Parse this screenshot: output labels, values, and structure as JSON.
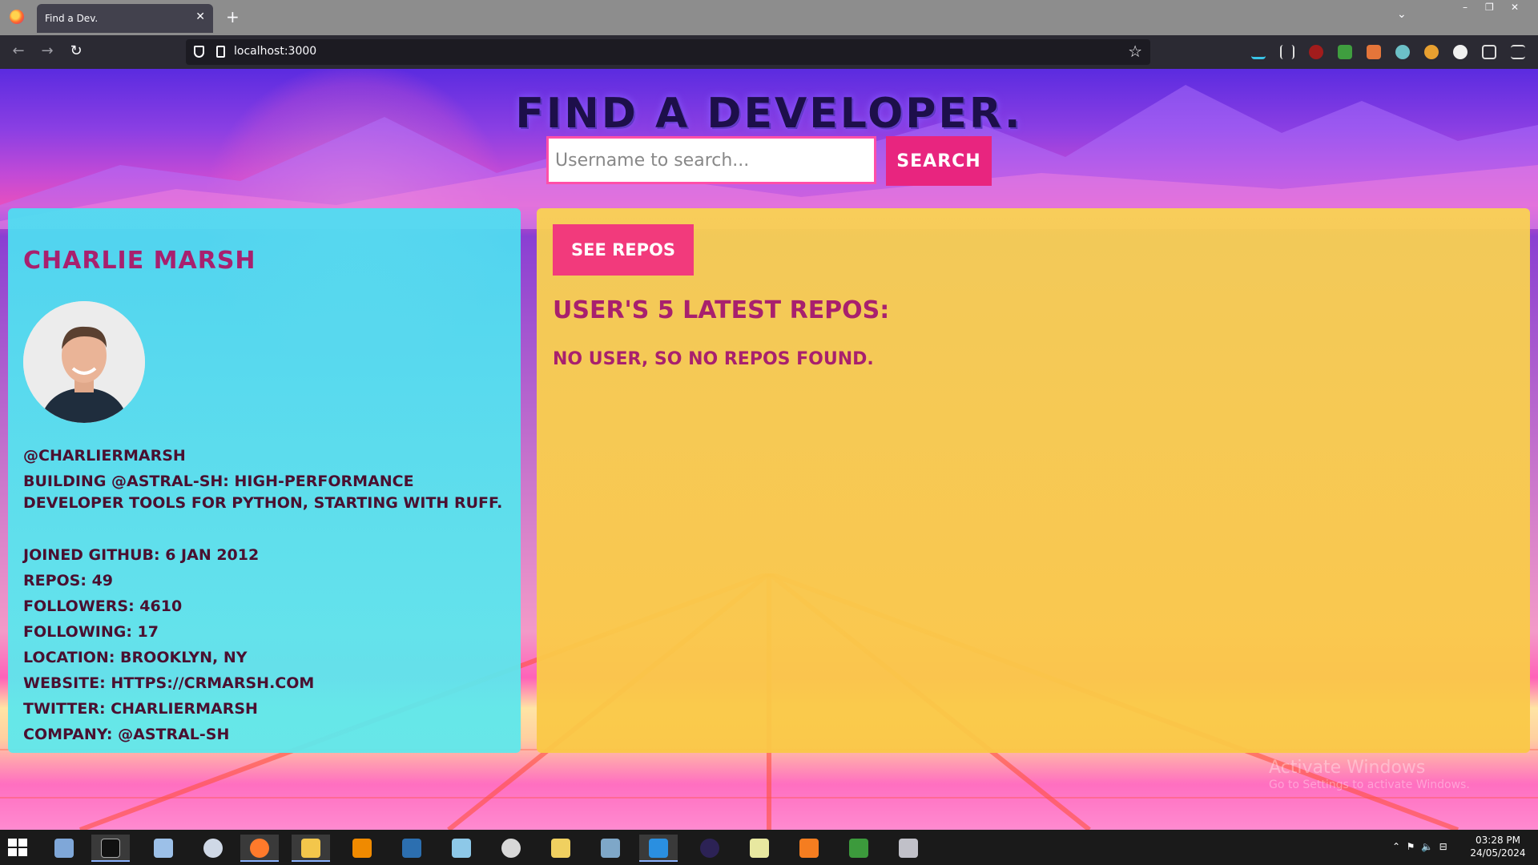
{
  "browser": {
    "tab_title": "Find a Dev.",
    "url": "localhost:3000"
  },
  "page": {
    "title": "Find a Developer.",
    "search_placeholder": "Username to search...",
    "search_button": "Search"
  },
  "profile": {
    "name": "Charlie Marsh",
    "handle": "@charliermarsh",
    "bio": "Building @astral-sh: high-performance developer tools for Python, starting with Ruff.",
    "joined": "Joined GitHub: 6 Jan 2012",
    "repos": "Repos: 49",
    "followers": "Followers: 4610",
    "following": "Following: 17",
    "location": "Location: Brooklyn, NY",
    "website": "Website: https://crmarsh.com",
    "twitter": "Twitter: charliermarsh",
    "company": "Company: @astral-sh"
  },
  "repos_panel": {
    "see_repos_button": "See Repos",
    "heading": "User's 5 latest repos:",
    "empty_message": "No user, so no repos found."
  },
  "watermark": {
    "title": "Activate Windows",
    "subtitle": "Go to Settings to activate Windows."
  },
  "taskbar": {
    "time": "03:28 PM",
    "date": "24/05/2024",
    "apps": [
      "network-computer-icon",
      "terminal-icon",
      "file-manager-icon",
      "steam-icon",
      "firefox-icon",
      "file-explorer-icon",
      "vlc-icon",
      "powershell-icon",
      "notepad-icon",
      "snipping-tool-icon",
      "folder-icon",
      "calculator-icon",
      "vscode-icon",
      "eclipse-icon",
      "chart-app-icon",
      "xampp-icon",
      "node-icon",
      "app-icon"
    ]
  },
  "colors": {
    "accent_pink": "#e8257f",
    "heading_magenta": "#a8206e",
    "profile_card": "#4ce0f2",
    "repos_card": "#fad450"
  }
}
